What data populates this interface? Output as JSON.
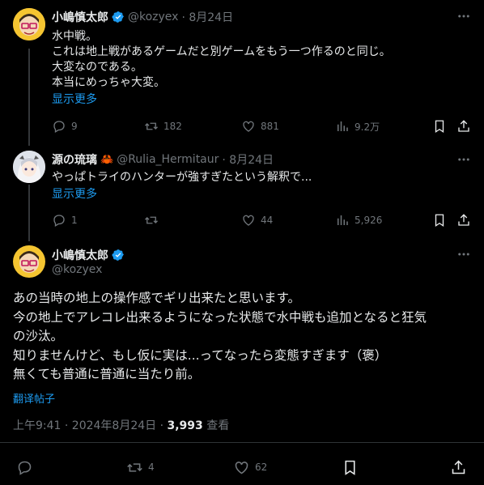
{
  "colors": {
    "background": "#000000",
    "text": "#e7e9ea",
    "muted": "#71767b",
    "link": "#1d9bf0",
    "verified": "#1d9bf0",
    "divider": "#2f3336"
  },
  "tweet1": {
    "name": "小嶋慎太郎",
    "handle": "@kozyex",
    "date": "· 8月24日",
    "lines": [
      "水中戦。",
      "これは地上戦があるゲームだと別ゲームをもう一つ作るのと同じ。",
      "大変なのである。",
      "本当にめっちゃ大変。"
    ],
    "show_more": "显示更多",
    "stats": {
      "replies": "9",
      "retweets": "182",
      "likes": "881",
      "views": "9.2万"
    }
  },
  "tweet2": {
    "name": "源の琉璃",
    "emoji": "🦀",
    "handle": "@Rulia_Hermitaur",
    "date": "· 8月24日",
    "lines": [
      "やっぱトライのハンターが強すぎたという解釈で..."
    ],
    "show_more": "显示更多",
    "stats": {
      "replies": "1",
      "retweets": "",
      "likes": "44",
      "views": "5,926"
    }
  },
  "main": {
    "name": "小嶋慎太郎",
    "handle": "@kozyex",
    "lines": [
      "あの当時の地上の操作感でギリ出来たと思います。",
      "今の地上でアレコレ出来るようになった状態で水中戦も追加となると狂気",
      "の沙汰。",
      "知りませんけど、もし仮に実は...ってなったら変態すぎます（褒）",
      "無くても普通に普通に当たり前。"
    ],
    "translate": "翻译帖子",
    "timestamp": "上午9:41 · 2024年8月24日 · ",
    "views_count": "3,993",
    "views_label": " 查看",
    "stats": {
      "replies": "",
      "retweets": "4",
      "likes": "62"
    }
  },
  "icons": [
    "more-icon",
    "reply-icon",
    "retweet-icon",
    "like-icon",
    "views-icon",
    "bookmark-icon",
    "share-icon",
    "verified-icon"
  ]
}
